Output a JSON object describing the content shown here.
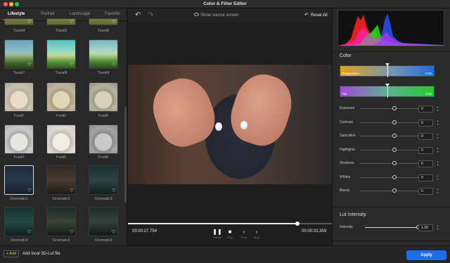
{
  "window": {
    "title": "Color & Filter Editor"
  },
  "tabs": [
    {
      "label": "Lifestyle",
      "active": true
    },
    {
      "label": "Portrait",
      "active": false
    },
    {
      "label": "Landscape",
      "active": false
    },
    {
      "label": "Favorite",
      "active": false
    }
  ],
  "presets": {
    "top_row": [
      "Travel4",
      "Travel5",
      "Travel6"
    ],
    "rows": [
      [
        "Travel7",
        "Travel8",
        "Travel9"
      ],
      [
        "Food1",
        "Food2",
        "Food3"
      ],
      [
        "Food4",
        "Food5",
        "Food6"
      ],
      [
        "Cinematic1",
        "Cinematic2",
        "Cinematic3"
      ],
      [
        "Cinematic4",
        "Cinematic5",
        "Cinematic6"
      ]
    ],
    "selected": "Cinematic1"
  },
  "bottom": {
    "add_label": "+ Add",
    "add_text": "Add local 3D-Lut file",
    "apply_label": "Apply"
  },
  "toolbar": {
    "show_source": "Show source screen",
    "reset": "Reset All"
  },
  "player": {
    "current_time": "00:00:27.754",
    "total_time": "00:00:33.359",
    "progress": 0.83,
    "controls": [
      {
        "icon": "pause-icon",
        "label": "Pause"
      },
      {
        "icon": "stop-icon",
        "label": "Stop"
      },
      {
        "icon": "prev-icon",
        "label": "Prev"
      },
      {
        "icon": "next-icon",
        "label": "Next"
      }
    ]
  },
  "color_panel": {
    "title": "Color",
    "temperature": {
      "label": "Temperature",
      "value": "0.00"
    },
    "tint": {
      "label": "Tint",
      "value": "0.00"
    },
    "adjustments": [
      {
        "label": "Exposure",
        "value": "0",
        "position": 0.5
      },
      {
        "label": "Contrast",
        "value": "0",
        "position": 0.5
      },
      {
        "label": "Saturation",
        "value": "0",
        "position": 0.5
      },
      {
        "label": "Highlights",
        "value": "0",
        "position": 0.5
      },
      {
        "label": "Shadows",
        "value": "0",
        "position": 0.5
      },
      {
        "label": "Whites",
        "value": "0",
        "position": 0.5
      },
      {
        "label": "Blacks",
        "value": "0",
        "position": 0.5
      }
    ]
  },
  "lut_panel": {
    "title": "Lut Intensity",
    "label": "Intensity",
    "value": "1.00",
    "position": 1.0
  },
  "colors": {
    "accent": "#1c6fe8",
    "tab_underline": "#e04848",
    "add_label": "#e8c341"
  }
}
